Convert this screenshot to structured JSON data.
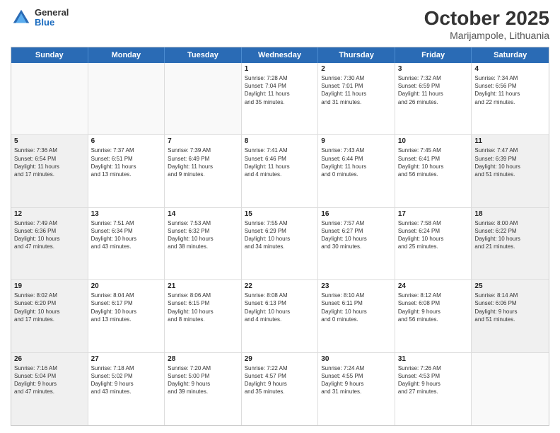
{
  "header": {
    "logo": {
      "general": "General",
      "blue": "Blue"
    },
    "title": "October 2025",
    "location": "Marijampole, Lithuania"
  },
  "weekdays": [
    "Sunday",
    "Monday",
    "Tuesday",
    "Wednesday",
    "Thursday",
    "Friday",
    "Saturday"
  ],
  "weeks": [
    [
      {
        "day": "",
        "info": "",
        "empty": true
      },
      {
        "day": "",
        "info": "",
        "empty": true
      },
      {
        "day": "",
        "info": "",
        "empty": true
      },
      {
        "day": "1",
        "info": "Sunrise: 7:28 AM\nSunset: 7:04 PM\nDaylight: 11 hours\nand 35 minutes."
      },
      {
        "day": "2",
        "info": "Sunrise: 7:30 AM\nSunset: 7:01 PM\nDaylight: 11 hours\nand 31 minutes."
      },
      {
        "day": "3",
        "info": "Sunrise: 7:32 AM\nSunset: 6:59 PM\nDaylight: 11 hours\nand 26 minutes."
      },
      {
        "day": "4",
        "info": "Sunrise: 7:34 AM\nSunset: 6:56 PM\nDaylight: 11 hours\nand 22 minutes."
      }
    ],
    [
      {
        "day": "5",
        "info": "Sunrise: 7:36 AM\nSunset: 6:54 PM\nDaylight: 11 hours\nand 17 minutes.",
        "shaded": true
      },
      {
        "day": "6",
        "info": "Sunrise: 7:37 AM\nSunset: 6:51 PM\nDaylight: 11 hours\nand 13 minutes."
      },
      {
        "day": "7",
        "info": "Sunrise: 7:39 AM\nSunset: 6:49 PM\nDaylight: 11 hours\nand 9 minutes."
      },
      {
        "day": "8",
        "info": "Sunrise: 7:41 AM\nSunset: 6:46 PM\nDaylight: 11 hours\nand 4 minutes."
      },
      {
        "day": "9",
        "info": "Sunrise: 7:43 AM\nSunset: 6:44 PM\nDaylight: 11 hours\nand 0 minutes."
      },
      {
        "day": "10",
        "info": "Sunrise: 7:45 AM\nSunset: 6:41 PM\nDaylight: 10 hours\nand 56 minutes."
      },
      {
        "day": "11",
        "info": "Sunrise: 7:47 AM\nSunset: 6:39 PM\nDaylight: 10 hours\nand 51 minutes.",
        "shaded": true
      }
    ],
    [
      {
        "day": "12",
        "info": "Sunrise: 7:49 AM\nSunset: 6:36 PM\nDaylight: 10 hours\nand 47 minutes.",
        "shaded": true
      },
      {
        "day": "13",
        "info": "Sunrise: 7:51 AM\nSunset: 6:34 PM\nDaylight: 10 hours\nand 43 minutes."
      },
      {
        "day": "14",
        "info": "Sunrise: 7:53 AM\nSunset: 6:32 PM\nDaylight: 10 hours\nand 38 minutes."
      },
      {
        "day": "15",
        "info": "Sunrise: 7:55 AM\nSunset: 6:29 PM\nDaylight: 10 hours\nand 34 minutes."
      },
      {
        "day": "16",
        "info": "Sunrise: 7:57 AM\nSunset: 6:27 PM\nDaylight: 10 hours\nand 30 minutes."
      },
      {
        "day": "17",
        "info": "Sunrise: 7:58 AM\nSunset: 6:24 PM\nDaylight: 10 hours\nand 25 minutes."
      },
      {
        "day": "18",
        "info": "Sunrise: 8:00 AM\nSunset: 6:22 PM\nDaylight: 10 hours\nand 21 minutes.",
        "shaded": true
      }
    ],
    [
      {
        "day": "19",
        "info": "Sunrise: 8:02 AM\nSunset: 6:20 PM\nDaylight: 10 hours\nand 17 minutes.",
        "shaded": true
      },
      {
        "day": "20",
        "info": "Sunrise: 8:04 AM\nSunset: 6:17 PM\nDaylight: 10 hours\nand 13 minutes."
      },
      {
        "day": "21",
        "info": "Sunrise: 8:06 AM\nSunset: 6:15 PM\nDaylight: 10 hours\nand 8 minutes."
      },
      {
        "day": "22",
        "info": "Sunrise: 8:08 AM\nSunset: 6:13 PM\nDaylight: 10 hours\nand 4 minutes."
      },
      {
        "day": "23",
        "info": "Sunrise: 8:10 AM\nSunset: 6:11 PM\nDaylight: 10 hours\nand 0 minutes."
      },
      {
        "day": "24",
        "info": "Sunrise: 8:12 AM\nSunset: 6:08 PM\nDaylight: 9 hours\nand 56 minutes."
      },
      {
        "day": "25",
        "info": "Sunrise: 8:14 AM\nSunset: 6:06 PM\nDaylight: 9 hours\nand 51 minutes.",
        "shaded": true
      }
    ],
    [
      {
        "day": "26",
        "info": "Sunrise: 7:16 AM\nSunset: 5:04 PM\nDaylight: 9 hours\nand 47 minutes.",
        "shaded": true
      },
      {
        "day": "27",
        "info": "Sunrise: 7:18 AM\nSunset: 5:02 PM\nDaylight: 9 hours\nand 43 minutes."
      },
      {
        "day": "28",
        "info": "Sunrise: 7:20 AM\nSunset: 5:00 PM\nDaylight: 9 hours\nand 39 minutes."
      },
      {
        "day": "29",
        "info": "Sunrise: 7:22 AM\nSunset: 4:57 PM\nDaylight: 9 hours\nand 35 minutes."
      },
      {
        "day": "30",
        "info": "Sunrise: 7:24 AM\nSunset: 4:55 PM\nDaylight: 9 hours\nand 31 minutes."
      },
      {
        "day": "31",
        "info": "Sunrise: 7:26 AM\nSunset: 4:53 PM\nDaylight: 9 hours\nand 27 minutes."
      },
      {
        "day": "",
        "info": "",
        "empty": true
      }
    ]
  ]
}
